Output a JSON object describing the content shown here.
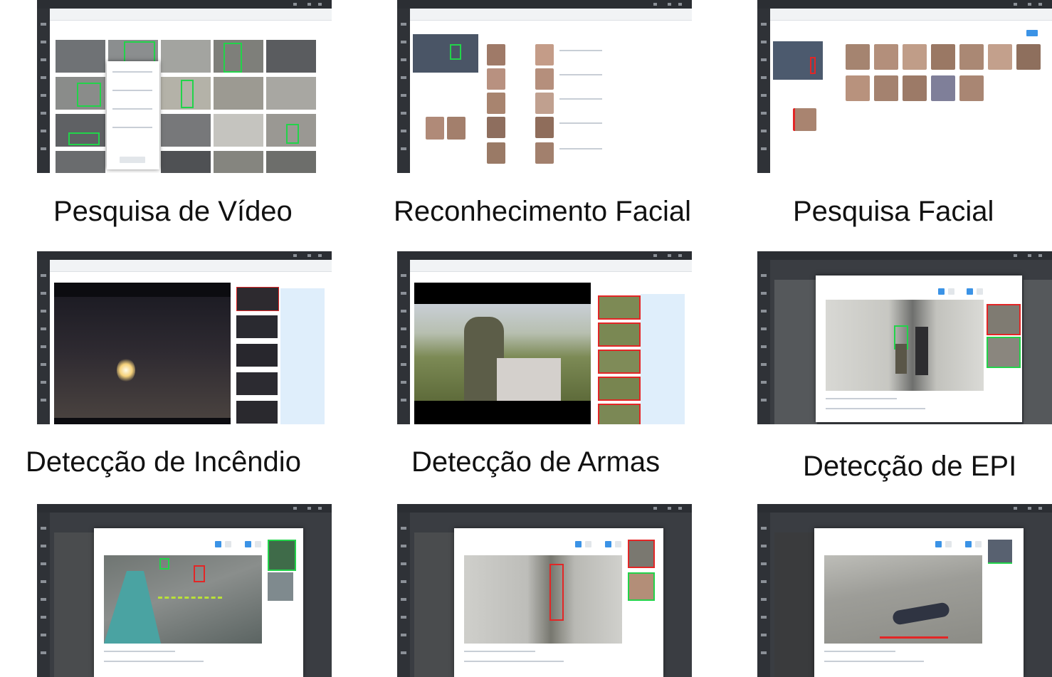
{
  "captions": {
    "video_search": "Pesquisa de Vídeo",
    "face_recognition": "Reconhecimento Facial",
    "face_search": "Pesquisa Facial",
    "fire_detection": "Detecção de Incêndio",
    "weapon_detection": "Detecção de Armas",
    "ppe_detection": "Detecção de EPI"
  },
  "colors": {
    "detection_box": "#22d34a",
    "alert_box": "#e32626",
    "accent_button": "#3b93e6",
    "app_chrome": "#2b2e33"
  },
  "icons": {
    "sidebar": "app-sidebar-icons",
    "toolbar": "toolbar-icons"
  }
}
